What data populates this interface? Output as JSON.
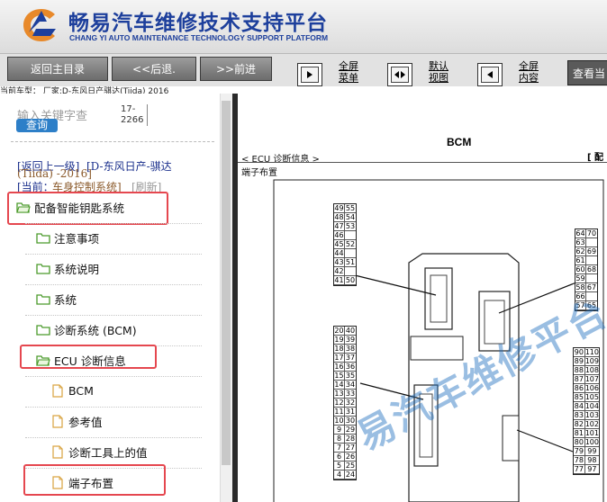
{
  "header": {
    "brand_cn": "畅易汽车维修技术支持平台",
    "brand_en": "CHANG YI AUTO MAINTENANCE TECHNOLOGY SUPPORT PLATFORM",
    "brand_color": "#1d3f9c"
  },
  "toolbar": {
    "home_label": "返回主目录",
    "back_label": "<<后退.",
    "forward_label": ">>前进",
    "fullscreen_menu": [
      "全屏",
      "菜单"
    ],
    "default_view": [
      "默认",
      "视图"
    ],
    "fullscreen_content": [
      "全屏",
      "内容"
    ],
    "view_button": "查看当"
  },
  "vehicle_info": "当前车型：  厂家:D-东风日产骐达(Tiida) 2016",
  "sidebar": {
    "search_placeholder": "输入关键字查",
    "search_button": "查询",
    "search_count": "17-\n2266",
    "breadcrumb": {
      "back": "[返回上一级]",
      "model": "[D-东风日产-骐达",
      "model_cont": "(Tiida) -2016]",
      "current_prefix": "[当前：",
      "current": "车身控制系统]",
      "refresh": "[刷新]"
    },
    "items": [
      {
        "label": "配备智能钥匙系统",
        "type": "folder",
        "level": 0,
        "highlighted": true
      },
      {
        "label": "注意事项",
        "type": "folder",
        "level": 1,
        "highlighted": false
      },
      {
        "label": "系统说明",
        "type": "folder",
        "level": 1,
        "highlighted": false
      },
      {
        "label": "系统",
        "type": "folder",
        "level": 1,
        "highlighted": false
      },
      {
        "label": "诊断系统 (BCM)",
        "type": "folder",
        "level": 1,
        "highlighted": false
      },
      {
        "label": "ECU 诊断信息",
        "type": "folder-open",
        "level": 1,
        "highlighted": true
      },
      {
        "label": "BCM",
        "type": "doc",
        "level": 2,
        "highlighted": false
      },
      {
        "label": "参考值",
        "type": "doc",
        "level": 2,
        "highlighted": false
      },
      {
        "label": "诊断工具上的值",
        "type": "doc",
        "level": 2,
        "highlighted": false
      },
      {
        "label": "端子布置",
        "type": "doc",
        "level": 2,
        "highlighted": true
      }
    ]
  },
  "document": {
    "title": "BCM",
    "section": "< ECU 诊断信息 >",
    "subsection": "端子布置",
    "ref_mark": "[ 配",
    "watermark": "易汽车维修平台",
    "connector_left_top": [
      "49",
      "55",
      "48",
      "54",
      "47",
      "53",
      "46",
      "45",
      "52",
      "44",
      "43",
      "51",
      "42",
      "41",
      "50"
    ],
    "connector_right_top": [
      "64",
      "70",
      "63",
      "62",
      "69",
      "61",
      "60",
      "68",
      "59",
      "58",
      "67",
      "66",
      "57",
      "65",
      "56"
    ],
    "connector_left_bottom": [
      "20",
      "40",
      "19",
      "39",
      "18",
      "38",
      "17",
      "37",
      "16",
      "36",
      "15",
      "35",
      "14",
      "34",
      "13",
      "33",
      "12",
      "32",
      "11",
      "31",
      "10",
      "30",
      "9",
      "29",
      "8",
      "28",
      "7",
      "27",
      "6",
      "26",
      "5",
      "25",
      "4",
      "24"
    ],
    "connector_right_bottom": [
      "90",
      "110",
      "89",
      "109",
      "88",
      "108",
      "87",
      "107",
      "86",
      "106",
      "85",
      "105",
      "84",
      "104",
      "83",
      "103",
      "82",
      "102",
      "81",
      "101",
      "80",
      "100",
      "79",
      "99",
      "78",
      "98",
      "77",
      "97",
      "76",
      "96"
    ]
  },
  "colors": {
    "highlight": "#e5474f",
    "link": "#1a2f8c",
    "search_button": "#2d7fc8",
    "folder_icon": "#4a9a2a"
  }
}
